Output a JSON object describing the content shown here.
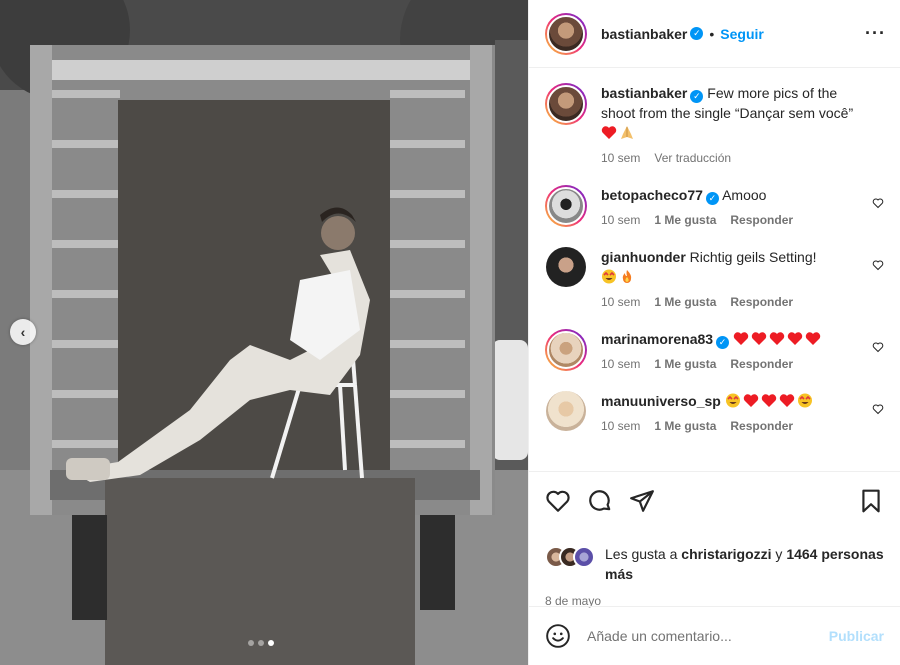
{
  "post": {
    "username": "bastianbaker",
    "follow_label": "Seguir",
    "separator": "•",
    "caption": "Few more pics of the shoot from the single “Dançar sem você”",
    "caption_time": "10 sem",
    "translate_label": "Ver traducción",
    "carousel_dots": 3,
    "carousel_active": 3
  },
  "comments": [
    {
      "username": "betopacheco77",
      "verified": true,
      "text": "Amooo",
      "time": "10 sem",
      "likes": "1 Me gusta",
      "reply": "Responder"
    },
    {
      "username": "gianhuonder",
      "verified": false,
      "text": "Richtig geils Setting!",
      "time": "10 sem",
      "likes": "1 Me gusta",
      "reply": "Responder"
    },
    {
      "username": "marinamorena83",
      "verified": true,
      "text": "",
      "time": "10 sem",
      "likes": "1 Me gusta",
      "reply": "Responder"
    },
    {
      "username": "manuuniverso_sp",
      "verified": false,
      "text": "",
      "time": "10 sem",
      "likes": "1 Me gusta",
      "reply": "Responder"
    }
  ],
  "likes": {
    "prefix": "Les gusta a",
    "user": "christarigozzi",
    "connector": "y",
    "count": "1464",
    "suffix": "personas más"
  },
  "date": "8 de mayo",
  "add_comment": {
    "placeholder": "Añade un comentario...",
    "publish_label": "Publicar"
  },
  "colors": {
    "accent": "#0095f6",
    "publish_disabled": "#b2dffc",
    "muted": "#737373",
    "heart_red": "#ed1c24"
  },
  "icons": [
    "chevron-left-icon",
    "more-icon",
    "verified-icon",
    "heart-icon",
    "comment-icon",
    "share-icon",
    "save-icon",
    "emoji-icon"
  ]
}
